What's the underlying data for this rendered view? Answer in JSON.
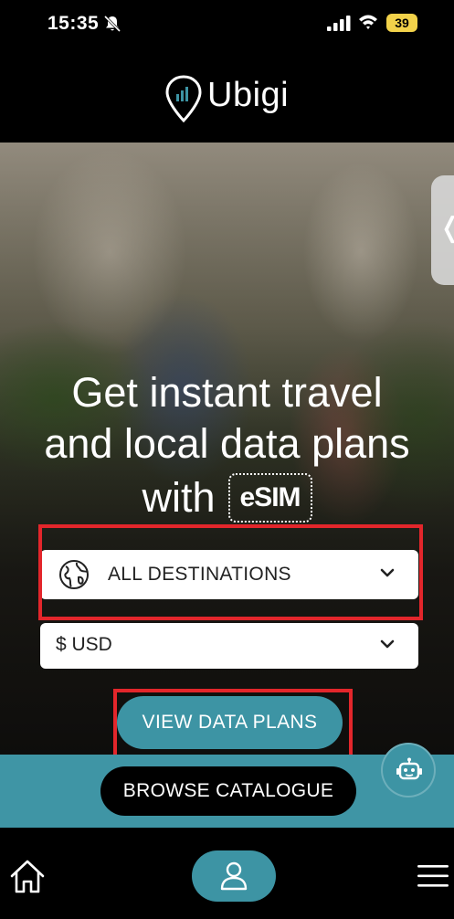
{
  "status_bar": {
    "time": "15:35",
    "battery_level": "39",
    "icons": [
      "bell-slash-icon",
      "signal-icon",
      "wifi-icon",
      "battery-icon"
    ]
  },
  "header": {
    "brand": "Ubigi",
    "logo_icon": "location-pin-signal-icon"
  },
  "hero": {
    "headline_line1": "Get instant travel",
    "headline_line2": "and local data plans",
    "headline_line3": "with",
    "esim_badge": "eSIM",
    "side_tab_icon": "chevron-left-icon"
  },
  "destination_select": {
    "value": "ALL DESTINATIONS",
    "icon": "globe-icon"
  },
  "currency_select": {
    "value": "$ USD"
  },
  "actions": {
    "view_plans_label": "VIEW DATA PLANS",
    "browse_label": "BROWSE CATALOGUE"
  },
  "bottom_nav": {
    "items": [
      "home-icon",
      "person-icon",
      "menu-icon"
    ]
  },
  "colors": {
    "accent": "#3d94a4",
    "highlight": "#e3262b",
    "battery": "#f2d24a"
  }
}
